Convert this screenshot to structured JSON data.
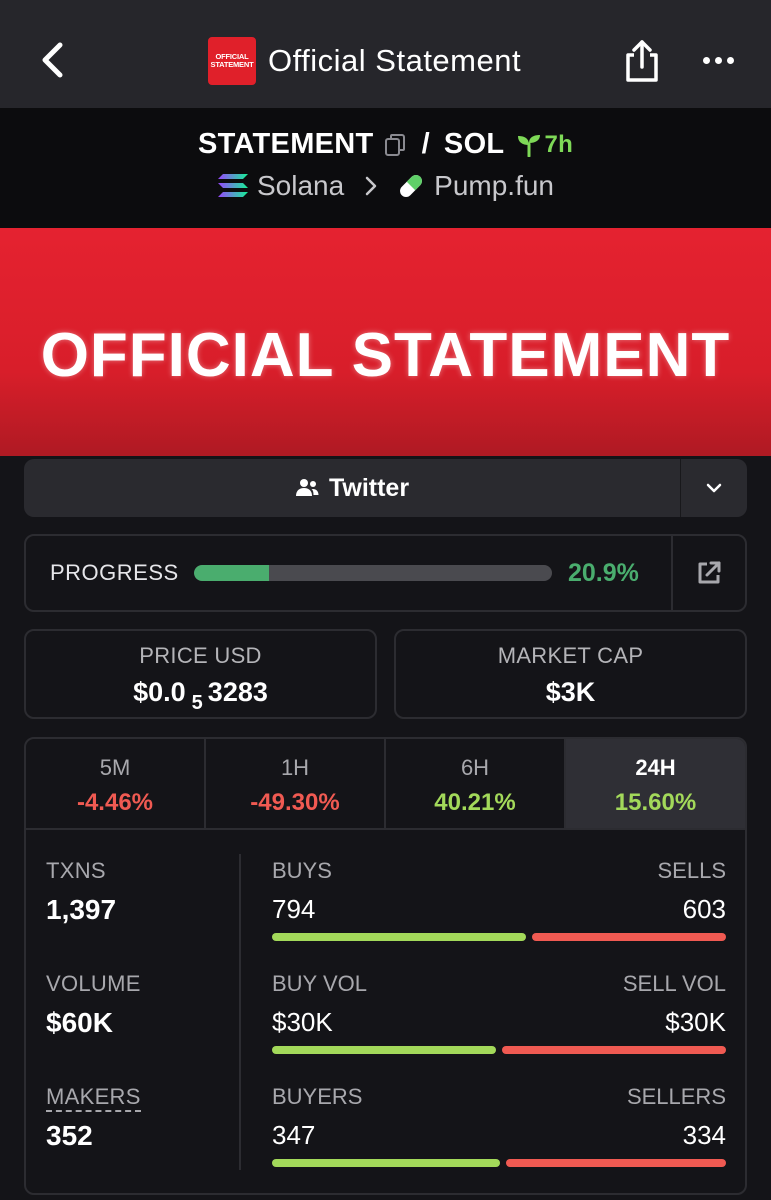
{
  "header": {
    "title": "Official Statement",
    "logo_text_line1": "OFFICIAL",
    "logo_text_line2": "STATEMENT",
    "icons": [
      "chevron-left-icon",
      "share-icon",
      "more-icon"
    ]
  },
  "pair": {
    "base": "STATEMENT",
    "quote": "SOL",
    "separator": "/",
    "age": "7h",
    "chain": "Solana",
    "dex": "Pump.fun"
  },
  "banner": {
    "text": "OFFICIAL STATEMENT",
    "color": "#e52230"
  },
  "social": {
    "twitter_label": "Twitter"
  },
  "progress": {
    "label": "PROGRESS",
    "value_text": "20.9%",
    "fraction": 0.209,
    "color": "#4aad6e"
  },
  "price": {
    "label": "PRICE USD",
    "prefix": "$0.0",
    "zeros_subscript": "5",
    "digits": "3283"
  },
  "market_cap": {
    "label": "MARKET CAP",
    "value": "$3K"
  },
  "timeframes": [
    {
      "label": "5M",
      "change": "-4.46%",
      "trend": "neg"
    },
    {
      "label": "1H",
      "change": "-49.30%",
      "trend": "neg"
    },
    {
      "label": "6H",
      "change": "40.21%",
      "trend": "pos"
    },
    {
      "label": "24H",
      "change": "15.60%",
      "trend": "pos",
      "active": true
    }
  ],
  "stats": {
    "txns": {
      "label": "TXNS",
      "value": "1,397"
    },
    "volume": {
      "label": "VOLUME",
      "value": "$60K"
    },
    "makers": {
      "label": "MAKERS",
      "value": "352"
    },
    "buys": {
      "left_label": "BUYS",
      "right_label": "SELLS",
      "left_value": "794",
      "right_value": "603",
      "left_fraction": 0.568
    },
    "vol_split": {
      "left_label": "BUY VOL",
      "right_label": "SELL VOL",
      "left_value": "$30K",
      "right_value": "$30K",
      "left_fraction": 0.5
    },
    "traders": {
      "left_label": "BUYERS",
      "right_label": "SELLERS",
      "left_value": "347",
      "right_value": "334",
      "left_fraction": 0.51
    }
  },
  "colors": {
    "positive": "#a3d95a",
    "negative": "#f05a52",
    "background": "#141418",
    "header": "#26262b"
  }
}
